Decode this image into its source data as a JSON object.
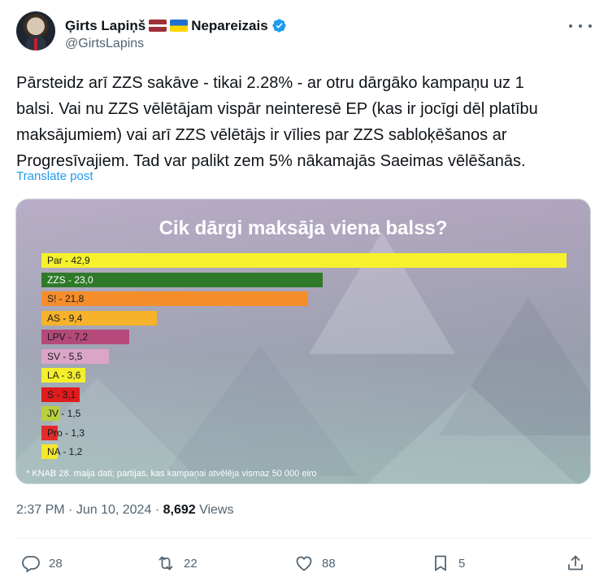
{
  "author": {
    "name": "Ģirts Lapiņš",
    "tagline": "Nepareizais",
    "handle": "@GirtsLapins"
  },
  "tweet": {
    "text": "Pārsteidz arī ZZS sakāve - tikai 2.28% - ar otru dārgāko kampaņu uz 1\nbalsi. Vai nu ZZS vēlētājam vispār neinteresē EP (kas ir jocīgi dēļ platību\nmaksājumiem) vai arī ZZS vēlētājs ir vīlies par ZZS sabloķēšanos ar\nProgresīvajiem. Tad var palikt zem 5% nākamajās Saeimas vēlēšanās.",
    "translate_label": "Translate post",
    "time": "2:37 PM",
    "date": "Jun 10, 2024",
    "views_count": "8,692",
    "views_label": "Views"
  },
  "actions": {
    "replies": "28",
    "reposts": "22",
    "likes": "88",
    "bookmarks": "5"
  },
  "icons": [
    "verified-badge-icon",
    "more-icon",
    "reply-icon",
    "repost-icon",
    "like-icon",
    "bookmark-icon",
    "share-icon"
  ],
  "chart_data": {
    "type": "bar",
    "title": "Cik dārgi maksāja viena balss?",
    "categories": [
      "Par",
      "ZZS",
      "S!",
      "AS",
      "LPV",
      "SV",
      "LA",
      "S",
      "JV",
      "Pro",
      "NA"
    ],
    "values": [
      42.9,
      23.0,
      21.8,
      9.4,
      7.2,
      5.5,
      3.6,
      3.1,
      1.5,
      1.3,
      1.2
    ],
    "labels": [
      "Par - 42,9",
      "ZZS - 23,0",
      "S! - 21,8",
      "AS - 9,4",
      "LPV - 7,2",
      "SV - 5,5",
      "LA - 3,6",
      "S - 3,1",
      "JV - 1,5",
      "Pro - 1,3",
      "NA - 1,2"
    ],
    "colors": [
      "#f5f12c",
      "#2f7a2a",
      "#f58e2a",
      "#f6b22a",
      "#b4497a",
      "#dba5c8",
      "#f5ef2a",
      "#e01b1b",
      "#b8cf3e",
      "#e42a2a",
      "#f3e92a"
    ],
    "footnote": "* KNAB 28. maija dati; partijas, kas kampaņai atvēlēja vismaz 50 000 eiro",
    "xlabel": "",
    "ylabel": ""
  }
}
